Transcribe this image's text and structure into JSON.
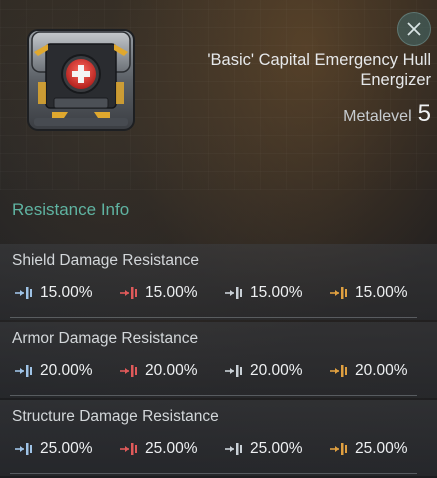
{
  "item": {
    "title": "'Basic' Capital Emergency Hull Energizer",
    "metalevel_label": "Metalevel",
    "metalevel_value": "5",
    "icon": "hull-energizer-crate-icon"
  },
  "close": {
    "icon": "close-icon"
  },
  "section": {
    "title": "Resistance Info"
  },
  "colors": {
    "accent": "#5fb3a1",
    "em": "#9fc3e6",
    "thermal": "#e05a5a",
    "kinetic": "#c9d0d6",
    "explosive": "#e0a040"
  },
  "resistances": [
    {
      "title": "Shield Damage Resistance",
      "values": [
        "15.00%",
        "15.00%",
        "15.00%",
        "15.00%"
      ]
    },
    {
      "title": "Armor Damage Resistance",
      "values": [
        "20.00%",
        "20.00%",
        "20.00%",
        "20.00%"
      ]
    },
    {
      "title": "Structure Damage Resistance",
      "values": [
        "25.00%",
        "25.00%",
        "25.00%",
        "25.00%"
      ]
    }
  ],
  "damage_types": [
    "em-damage-icon",
    "thermal-damage-icon",
    "kinetic-damage-icon",
    "explosive-damage-icon"
  ]
}
